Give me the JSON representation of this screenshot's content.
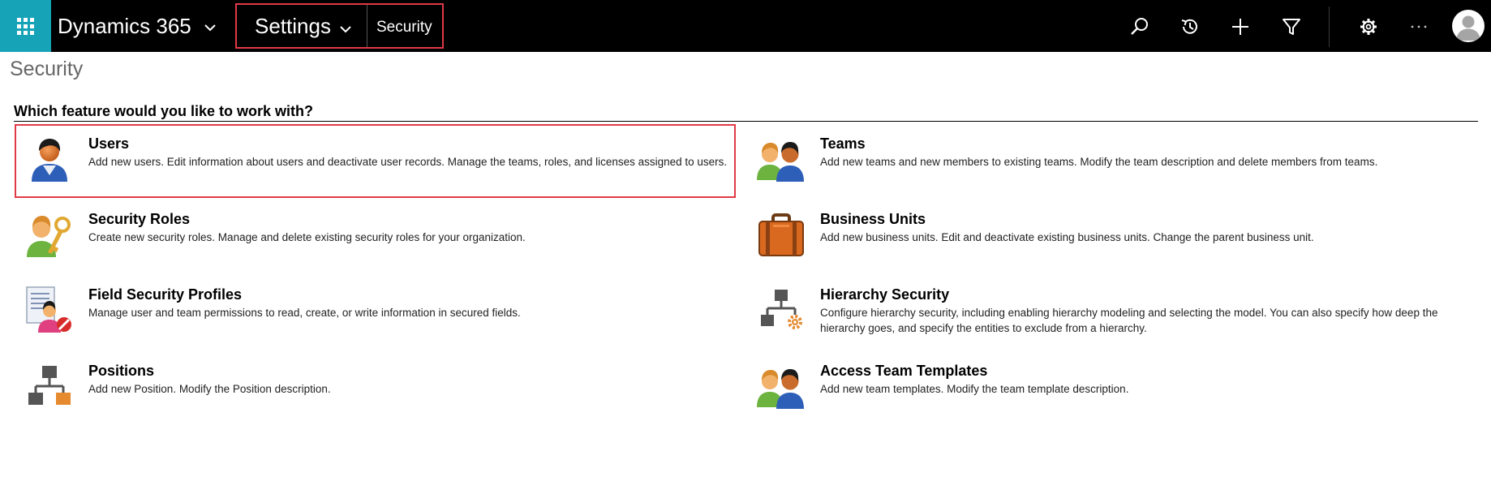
{
  "header": {
    "app_title": "Dynamics 365",
    "area_title": "Settings",
    "breadcrumb": "Security",
    "toolbar_icons": [
      "search-icon",
      "history-icon",
      "add-icon",
      "filter-icon",
      "settings-gear-icon",
      "more-options-icon",
      "user-avatar"
    ],
    "colors": {
      "bar": "#000000",
      "waffle": "#16a3b8",
      "highlight": "#e03a46"
    }
  },
  "page": {
    "title": "Security",
    "question": "Which feature would you like to work with?"
  },
  "features": [
    {
      "title": "Users",
      "description": "Add new users. Edit information about users and deactivate user records. Manage the teams, roles, and licenses assigned to users.",
      "icon": "user-icon"
    },
    {
      "title": "Teams",
      "description": "Add new teams and new members to existing teams. Modify the team description and delete members from teams.",
      "icon": "team-icon"
    },
    {
      "title": "Security Roles",
      "description": "Create new security roles. Manage and delete existing security roles for your organization.",
      "icon": "security-role-key-icon"
    },
    {
      "title": "Business Units",
      "description": "Add new business units. Edit and deactivate existing business units. Change the parent business unit.",
      "icon": "briefcase-icon"
    },
    {
      "title": "Field Security Profiles",
      "description": "Manage user and team permissions to read, create, or write information in secured fields.",
      "icon": "field-security-profile-icon"
    },
    {
      "title": "Hierarchy Security",
      "description": "Configure hierarchy security, including enabling hierarchy modeling and selecting the model. You can also specify how deep the hierarchy goes, and specify the entities to exclude from a hierarchy.",
      "icon": "hierarchy-gear-icon"
    },
    {
      "title": "Positions",
      "description": "Add new Position. Modify the Position description.",
      "icon": "position-hierarchy-icon"
    },
    {
      "title": "Access Team Templates",
      "description": "Add new team templates. Modify the team template description.",
      "icon": "team-icon"
    }
  ]
}
